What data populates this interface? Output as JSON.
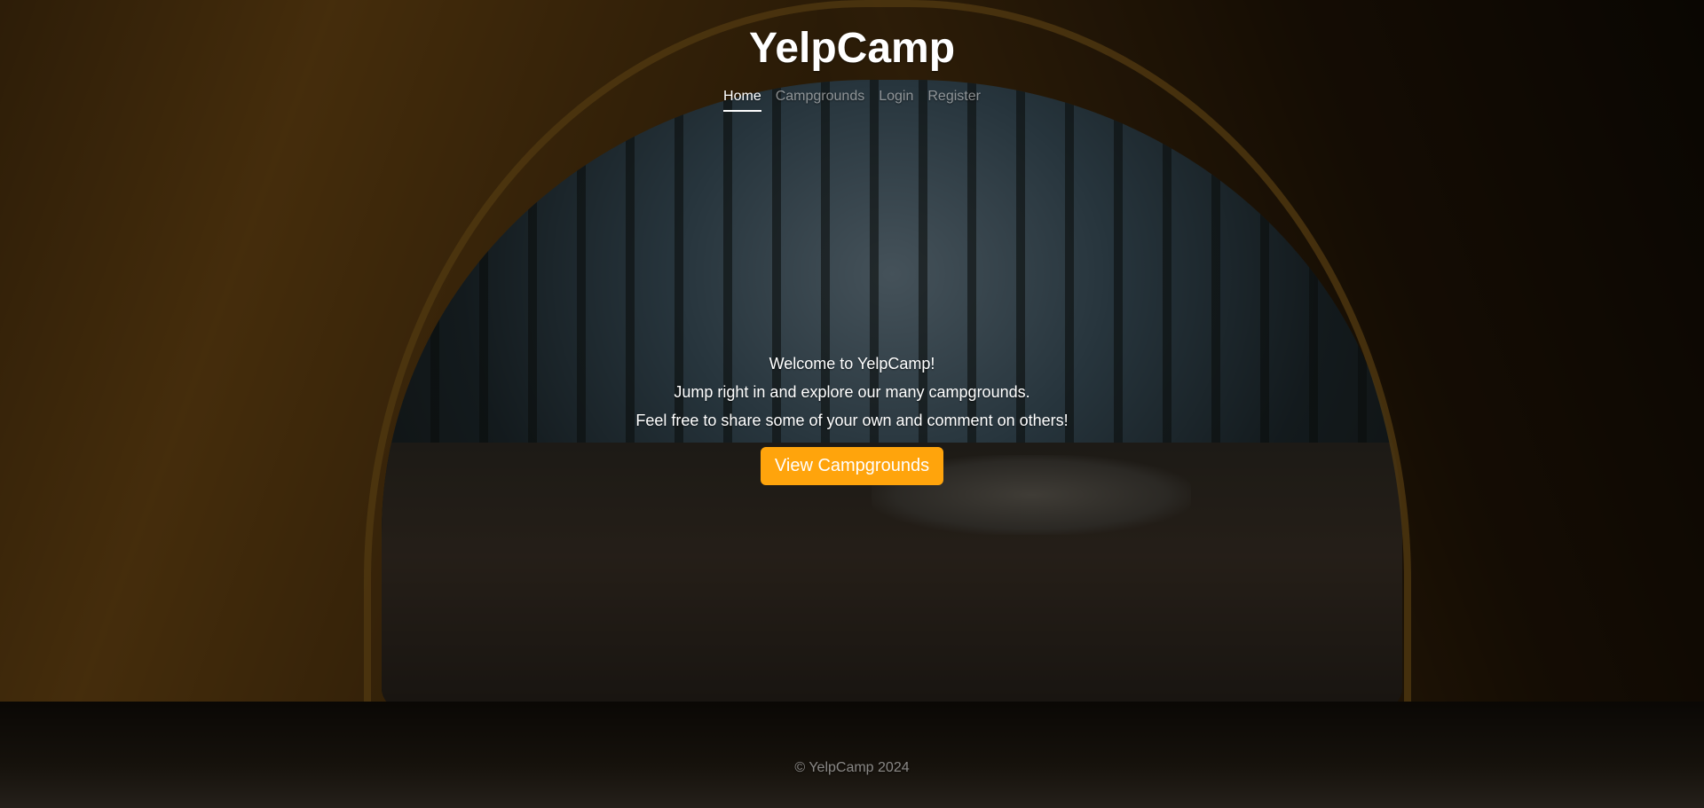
{
  "app": {
    "title": "YelpCamp"
  },
  "nav": {
    "items": [
      {
        "label": "Home",
        "active": true
      },
      {
        "label": "Campgrounds",
        "active": false
      },
      {
        "label": "Login",
        "active": false
      },
      {
        "label": "Register",
        "active": false
      }
    ]
  },
  "hero": {
    "lines": [
      "Welcome to YelpCamp!",
      "Jump right in and explore our many campgrounds.",
      "Feel free to share some of your own and comment on others!"
    ],
    "button_label": "View Campgrounds"
  },
  "footer": {
    "text": "© YelpCamp 2024"
  },
  "colors": {
    "accent": "#ffa40c",
    "text": "#ffffff",
    "muted_text": "rgba(255,255,255,0.5)"
  }
}
